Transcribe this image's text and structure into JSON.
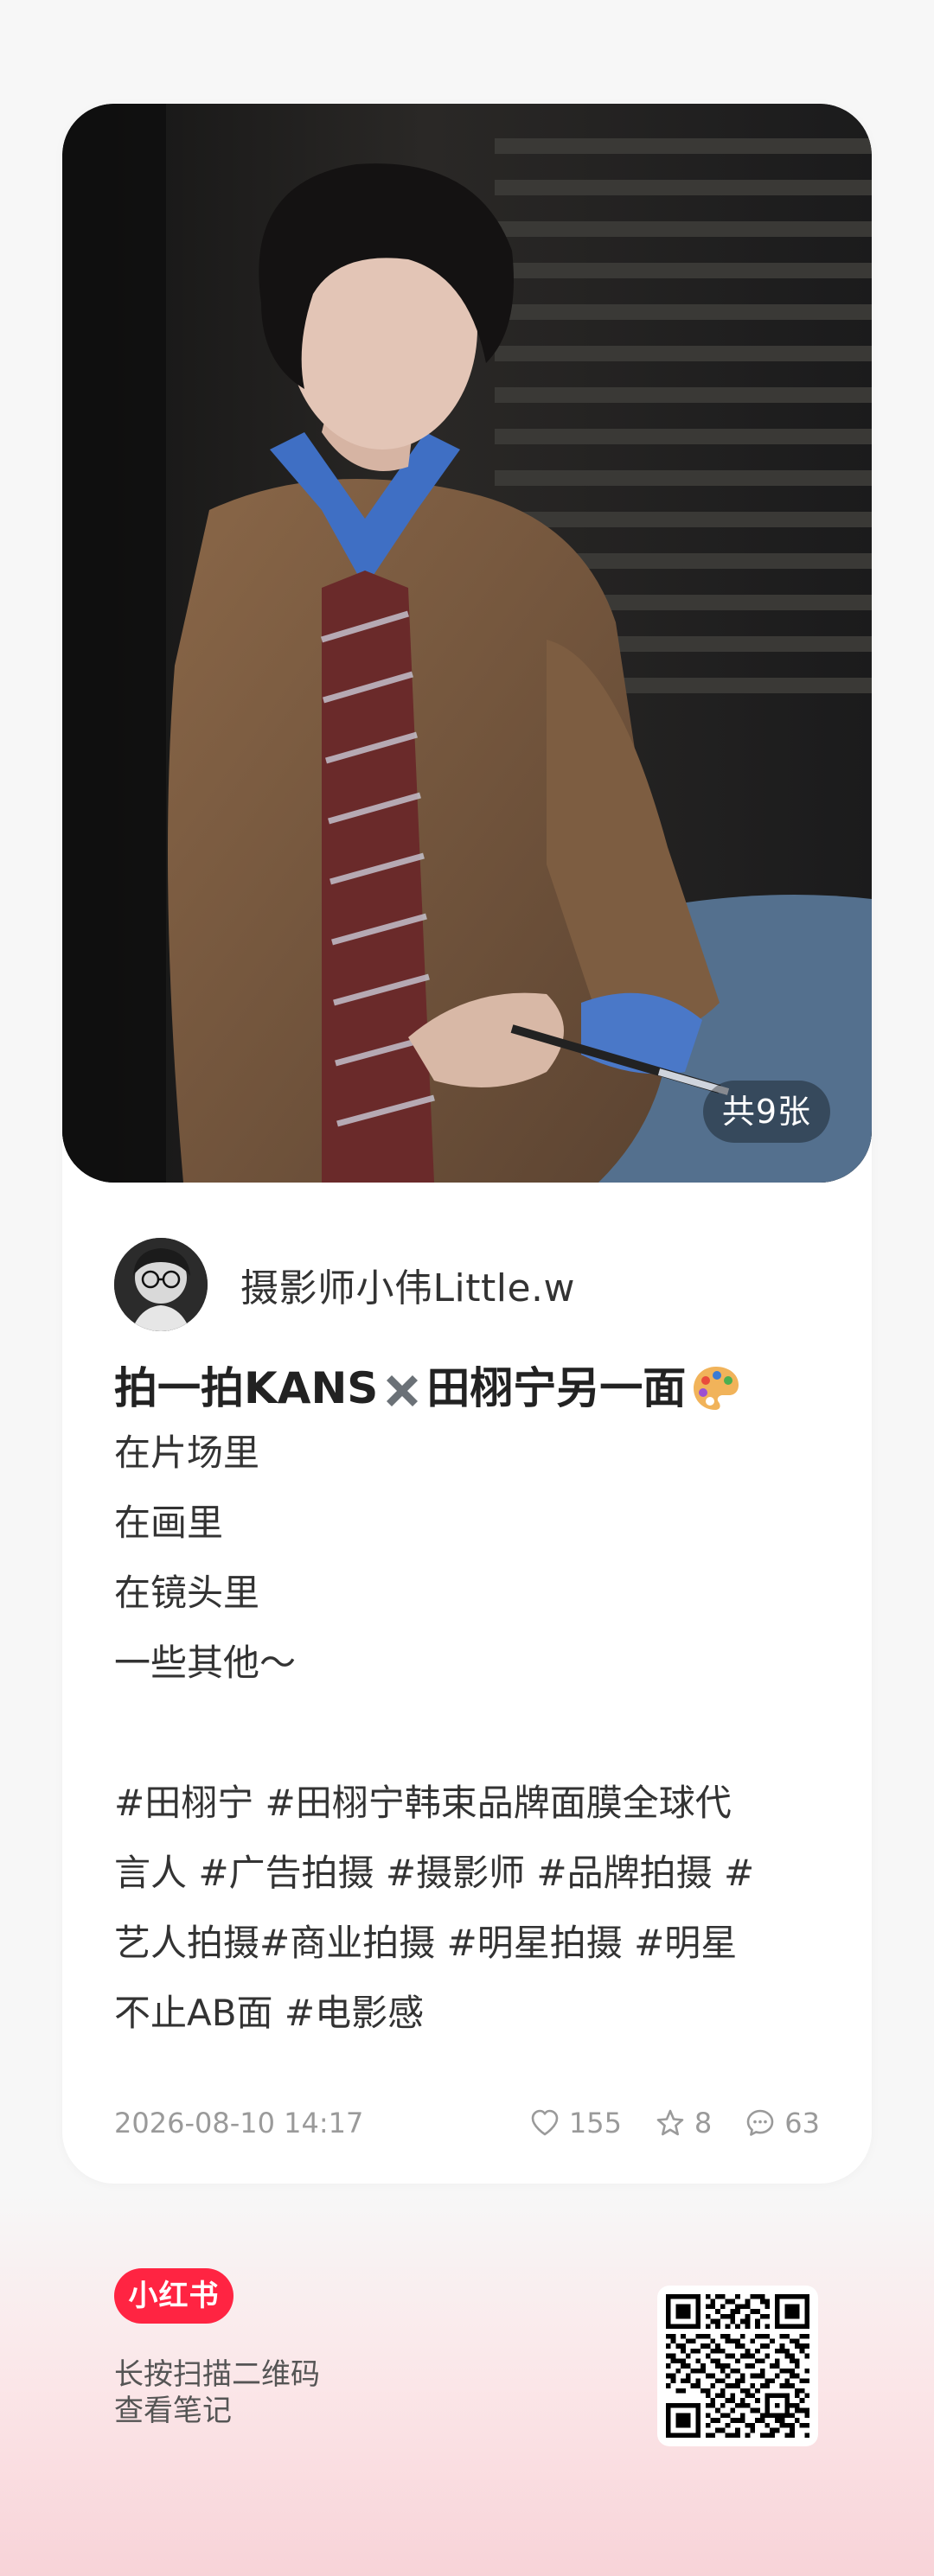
{
  "post": {
    "image_count_label": "共9张",
    "author_name": "摄影师小伟Little.w",
    "title_part1": "拍一拍KANS",
    "title_part2": "田栩宁另一面",
    "body_lines": [
      "在片场里",
      "在画里",
      "在镜头里",
      "一些其他～"
    ],
    "tag_lines": [
      "#田栩宁 #田栩宁韩束品牌面膜全球代",
      "言人 #广告拍摄 #摄影师 #品牌拍摄 #",
      "艺人拍摄#商业拍摄 #明星拍摄 #明星",
      "不止AB面 #电影感"
    ],
    "date": "2026-08-10 14:17",
    "likes": "155",
    "collects": "8",
    "comments": "63"
  },
  "footer": {
    "brand": "小红书",
    "scan_hint_line1": "长按扫描二维码",
    "scan_hint_line2": "查看笔记"
  },
  "colors": {
    "brand_red": "#ff2442",
    "page_bg": "#f7f7f7",
    "footer_pink": "#f8d3d8"
  }
}
